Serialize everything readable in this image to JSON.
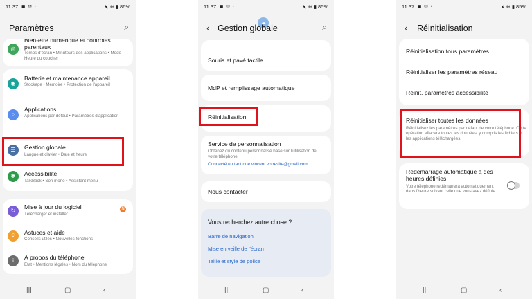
{
  "phone1": {
    "status": {
      "time": "11:37",
      "battery": "86%"
    },
    "title": "Paramètres",
    "items": [
      {
        "title": "Bien-être numérique et contrôles parentaux",
        "subtitle": "Temps d'écran • Minuteurs des applications • Mode Heure du coucher",
        "icon_color": "#3fa55a"
      },
      {
        "title": "Batterie et maintenance appareil",
        "subtitle": "Stockage • Mémoire • Protection de l'appareil",
        "icon_color": "#1aa39a"
      },
      {
        "title": "Applications",
        "subtitle": "Applications par défaut • Paramètres d'application",
        "icon_color": "#5b8cf0"
      },
      {
        "title": "Gestion globale",
        "subtitle": "Langue et clavier • Date et heure",
        "icon_color": "#4a6fa5"
      },
      {
        "title": "Accessibilité",
        "subtitle": "TalkBack • Son mono • Assistant menu",
        "icon_color": "#2d9b4a"
      },
      {
        "title": "Mise à jour du logiciel",
        "subtitle": "Télécharger et installer",
        "icon_color": "#7a5cd6",
        "badge": "N"
      },
      {
        "title": "Astuces et aide",
        "subtitle": "Conseils utiles • Nouvelles fonctions",
        "icon_color": "#f0a030"
      },
      {
        "title": "À propos du téléphone",
        "subtitle": "État • Mentions légales • Nom du téléphone",
        "icon_color": "#6d6d6d"
      }
    ]
  },
  "phone2": {
    "status": {
      "time": "11:37",
      "battery": "85%"
    },
    "title": "Gestion globale",
    "items": {
      "souris": "Souris et pavé tactile",
      "mdp": "MdP et remplissage automatique",
      "reinit": "Réinitialisation",
      "service_title": "Service de personnalisation",
      "service_sub": "Obtenez du contenu personnalisé basé sur l'utilisation de votre téléphone.",
      "service_account": "Connecté en tant que vincent.votresite@gmail.com",
      "contact": "Nous contacter"
    },
    "suggest": {
      "title": "Vous recherchez autre chose ?",
      "links": [
        "Barre de navigation",
        "Mise en veille de l'écran",
        "Taille et style de police"
      ]
    }
  },
  "phone3": {
    "status": {
      "time": "11:37",
      "battery": "85%"
    },
    "title": "Réinitialisation",
    "items": {
      "tous": "Réinitialisation tous paramètres",
      "reseau": "Réinitialiser les paramètres réseau",
      "access": "Réinit. paramètres accessibilité",
      "donnees_title": "Réinitialiser toutes les données",
      "donnees_desc": "Réinitialisez les paramètres par défaut de votre téléphone. Cette opération effacera toutes les données, y compris les fichiers et les applications téléchargées.",
      "auto_title": "Redémarrage automatique à des heures définies",
      "auto_desc": "Votre téléphone redémarrera automatiquement dans l'heure suivant celle que vous avez définie."
    },
    "toggle_on": false
  },
  "highlight_color": "#e0131d"
}
